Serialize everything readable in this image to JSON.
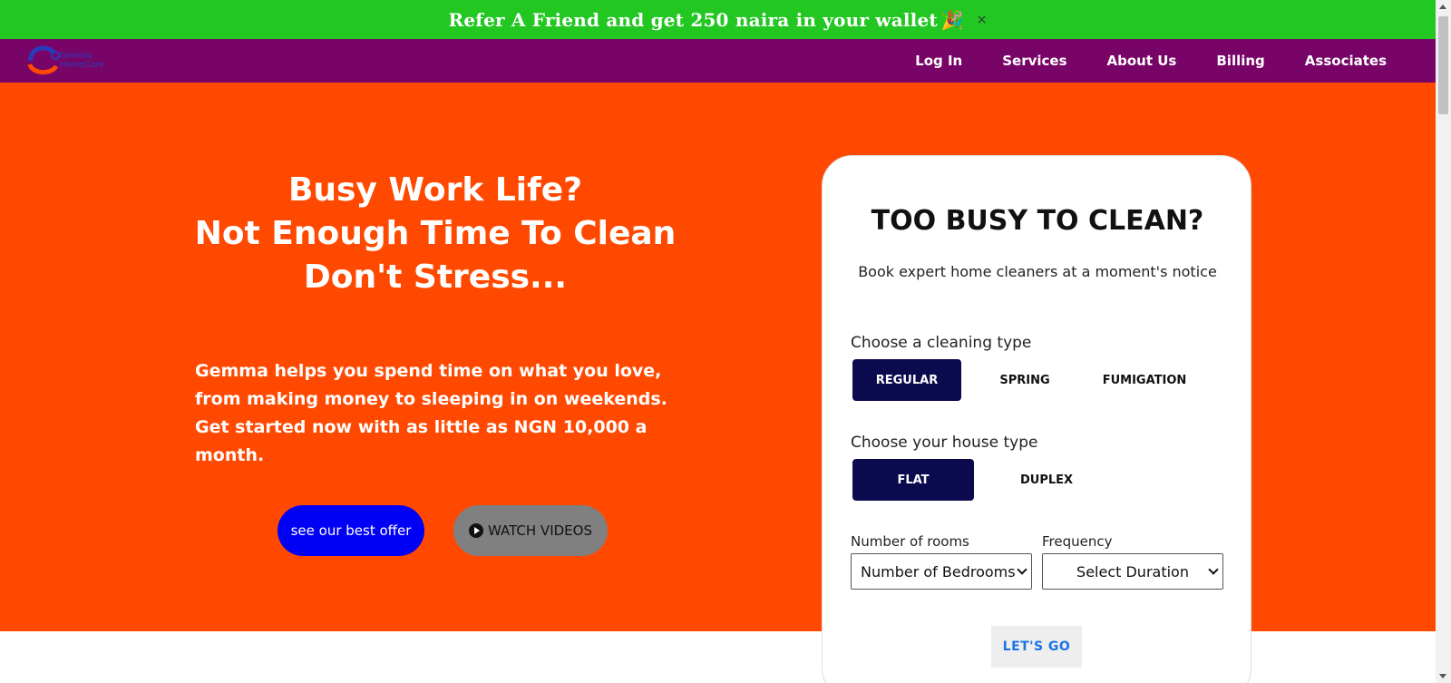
{
  "promo": {
    "text": "Refer A Friend and get 250 naira in your wallet",
    "emoji": "🎉",
    "close": "×"
  },
  "nav": {
    "logo_text_1": "Gemma",
    "logo_text_2": "HomeCare",
    "links": [
      "Log In",
      "Services",
      "About Us",
      "Billing",
      "Associates"
    ]
  },
  "hero": {
    "title_lines": [
      "Busy Work Life?",
      "Not Enough Time To Clean",
      "Don't Stress..."
    ],
    "description": "Gemma helps you spend time on what you love, from making money to sleeping in on weekends. Get started now with as little as NGN 10,000 a month.",
    "offer_button": "see our best offer",
    "videos_button": "WATCH VIDEOS"
  },
  "booking": {
    "title": "TOO BUSY TO CLEAN?",
    "subtitle": "Book expert home cleaners at a moment's notice",
    "cleaning_type_label": "Choose a cleaning type",
    "cleaning_types": [
      "REGULAR",
      "SPRING",
      "FUMIGATION"
    ],
    "selected_cleaning_type": "REGULAR",
    "house_type_label": "Choose your house type",
    "house_types": [
      "FLAT",
      "DUPLEX"
    ],
    "selected_house_type": "FLAT",
    "rooms_label": "Number of rooms",
    "rooms_value": "Number of Bedrooms",
    "frequency_label": "Frequency",
    "frequency_value": "Select Duration",
    "submit": "LET'S GO"
  },
  "colors": {
    "promo_bg": "#22c722",
    "nav_bg": "#770466",
    "hero_bg": "#ff4900",
    "offer_btn": "#0000f5",
    "videos_btn": "#808080",
    "active_option": "#0b0a4e",
    "go_text": "#1b73e8"
  }
}
